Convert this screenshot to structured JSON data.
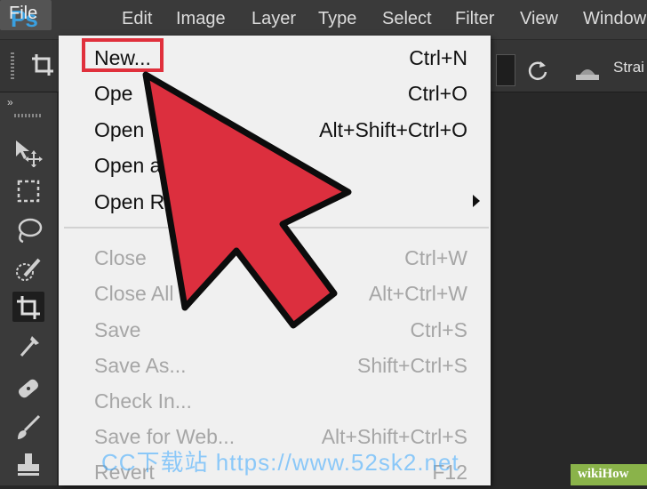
{
  "app": {
    "logo": "Ps"
  },
  "menubar": {
    "items": [
      "File",
      "Edit",
      "Image",
      "Layer",
      "Type",
      "Select",
      "Filter",
      "View",
      "Window"
    ]
  },
  "optionsbar": {
    "straighten_label": "Strai"
  },
  "file_menu": {
    "items": [
      {
        "label": "New...",
        "shortcut": "Ctrl+N",
        "enabled": true
      },
      {
        "label": "Ope",
        "shortcut": "Ctrl+O",
        "enabled": true
      },
      {
        "label": "Open",
        "shortcut": "Alt+Shift+Ctrl+O",
        "enabled": true
      },
      {
        "label": "Open a",
        "shortcut": "",
        "enabled": true
      },
      {
        "label": "Open R",
        "shortcut": "",
        "enabled": true,
        "submenu": true
      },
      {
        "label": "Close",
        "shortcut": "Ctrl+W",
        "enabled": false
      },
      {
        "label": "Close All",
        "shortcut": "Alt+Ctrl+W",
        "enabled": false
      },
      {
        "label": "Save",
        "shortcut": "Ctrl+S",
        "enabled": false
      },
      {
        "label": "Save As...",
        "shortcut": "Shift+Ctrl+S",
        "enabled": false
      },
      {
        "label": "Check In...",
        "shortcut": "",
        "enabled": false
      },
      {
        "label": "Save for Web...",
        "shortcut": "Alt+Shift+Ctrl+S",
        "enabled": false
      },
      {
        "label": "Revert",
        "shortcut": "F12",
        "enabled": false
      }
    ]
  },
  "toolbar": {
    "collapse": "»",
    "tools": [
      "move-tool",
      "marquee-tool",
      "lasso-tool",
      "quick-selection-tool",
      "crop-tool",
      "eyedropper-tool",
      "healing-brush-tool",
      "brush-tool",
      "clone-stamp-tool"
    ],
    "active_tool": "crop-tool"
  },
  "colors": {
    "menu_bg": "#f0f0f0",
    "app_bg": "#3a3a3a",
    "highlight": "#e0303c",
    "arrow_fill": "#dc2f3e",
    "disabled_text": "#a6a6a6"
  },
  "watermark": {
    "text": "CC下载站 https://www.52sk2.net"
  },
  "wikihow": {
    "text": "wikiHow"
  }
}
